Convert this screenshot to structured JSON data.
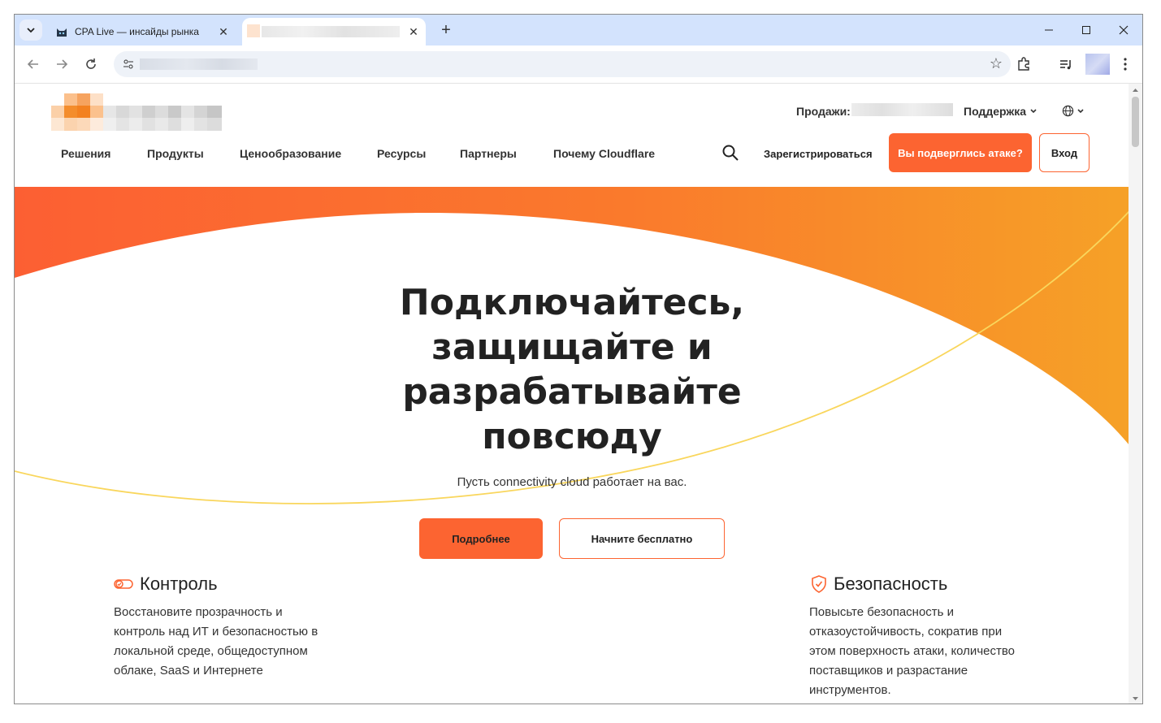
{
  "browser": {
    "tabs": [
      {
        "title": "CPA Live — инсайды рынка",
        "favicon": "cat-favicon-icon"
      },
      {
        "title": ""
      }
    ],
    "address": ""
  },
  "site": {
    "topbar": {
      "sales_label": "Продажи:",
      "support_label": "Поддержка",
      "language_icon": "globe-icon"
    },
    "nav": [
      "Решения",
      "Продукты",
      "Ценообразование",
      "Ресурсы",
      "Партнеры",
      "Почему Cloudflare"
    ],
    "signup": "Зарегистрироваться",
    "attack_button": "Вы подверглись атаке?",
    "login_button": "Вход",
    "hero": {
      "title_lines": [
        "Подключайтесь,",
        "защищайте и",
        "разрабатывайте",
        "повсюду"
      ],
      "subtitle": "Пусть connectivity cloud работает на вас.",
      "primary_button": "Подробнее",
      "secondary_button": "Начните бесплатно"
    },
    "features": [
      {
        "title": "Контроль",
        "icon": "toggle-check-icon",
        "lines": [
          "Восстановите прозрачность и",
          "контроль над ИТ и безопасностью в",
          "локальной среде, общедоступном",
          "облаке, SaaS и Интернете"
        ]
      },
      {
        "title": "Безопасность",
        "icon": "shield-check-icon",
        "lines": [
          "Повысьте безопасность и",
          "отказоустойчивость, сократив при",
          "этом поверхность атаки, количество",
          "поставщиков и разрастание",
          "инструментов."
        ]
      }
    ]
  },
  "colors": {
    "accent": "#fc6431",
    "gradient_end": "#f6a127",
    "line_yellow": "#f9d65c"
  }
}
